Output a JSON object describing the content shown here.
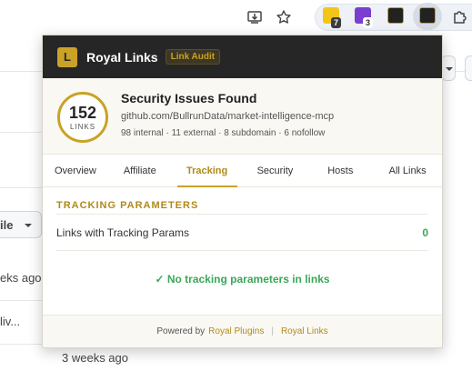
{
  "browser": {
    "ext_badges": [
      "7",
      "3"
    ]
  },
  "background": {
    "dropdown_label": "ile",
    "row1_time": "eks ago",
    "row2_text": "liv...",
    "row3_time": "3 weeks ago"
  },
  "popup": {
    "logo_letter": "L",
    "brand": "Royal Links",
    "mode_badge": "Link Audit",
    "summary": {
      "count": "152",
      "count_label": "LINKS",
      "title": "Security Issues Found",
      "url": "github.com/BullrunData/market-intelligence-mcp",
      "stats": "98 internal · 11 external · 8 subdomain · 6 nofollow"
    },
    "tabs": [
      {
        "label": "Overview"
      },
      {
        "label": "Affiliate"
      },
      {
        "label": "Tracking",
        "active": true
      },
      {
        "label": "Security"
      },
      {
        "label": "Hosts"
      },
      {
        "label": "All Links"
      }
    ],
    "section": {
      "title": "TRACKING PARAMETERS",
      "row_label": "Links with Tracking Params",
      "row_value": "0",
      "ok_message": "✓ No tracking parameters in links"
    },
    "footer": {
      "powered_by": "Powered by",
      "link1": "Royal Plugins",
      "separator": "|",
      "link2": "Royal Links"
    }
  },
  "colors": {
    "accent_gold": "#c9a227",
    "header_dark": "#262626",
    "success_green": "#3aa759"
  }
}
